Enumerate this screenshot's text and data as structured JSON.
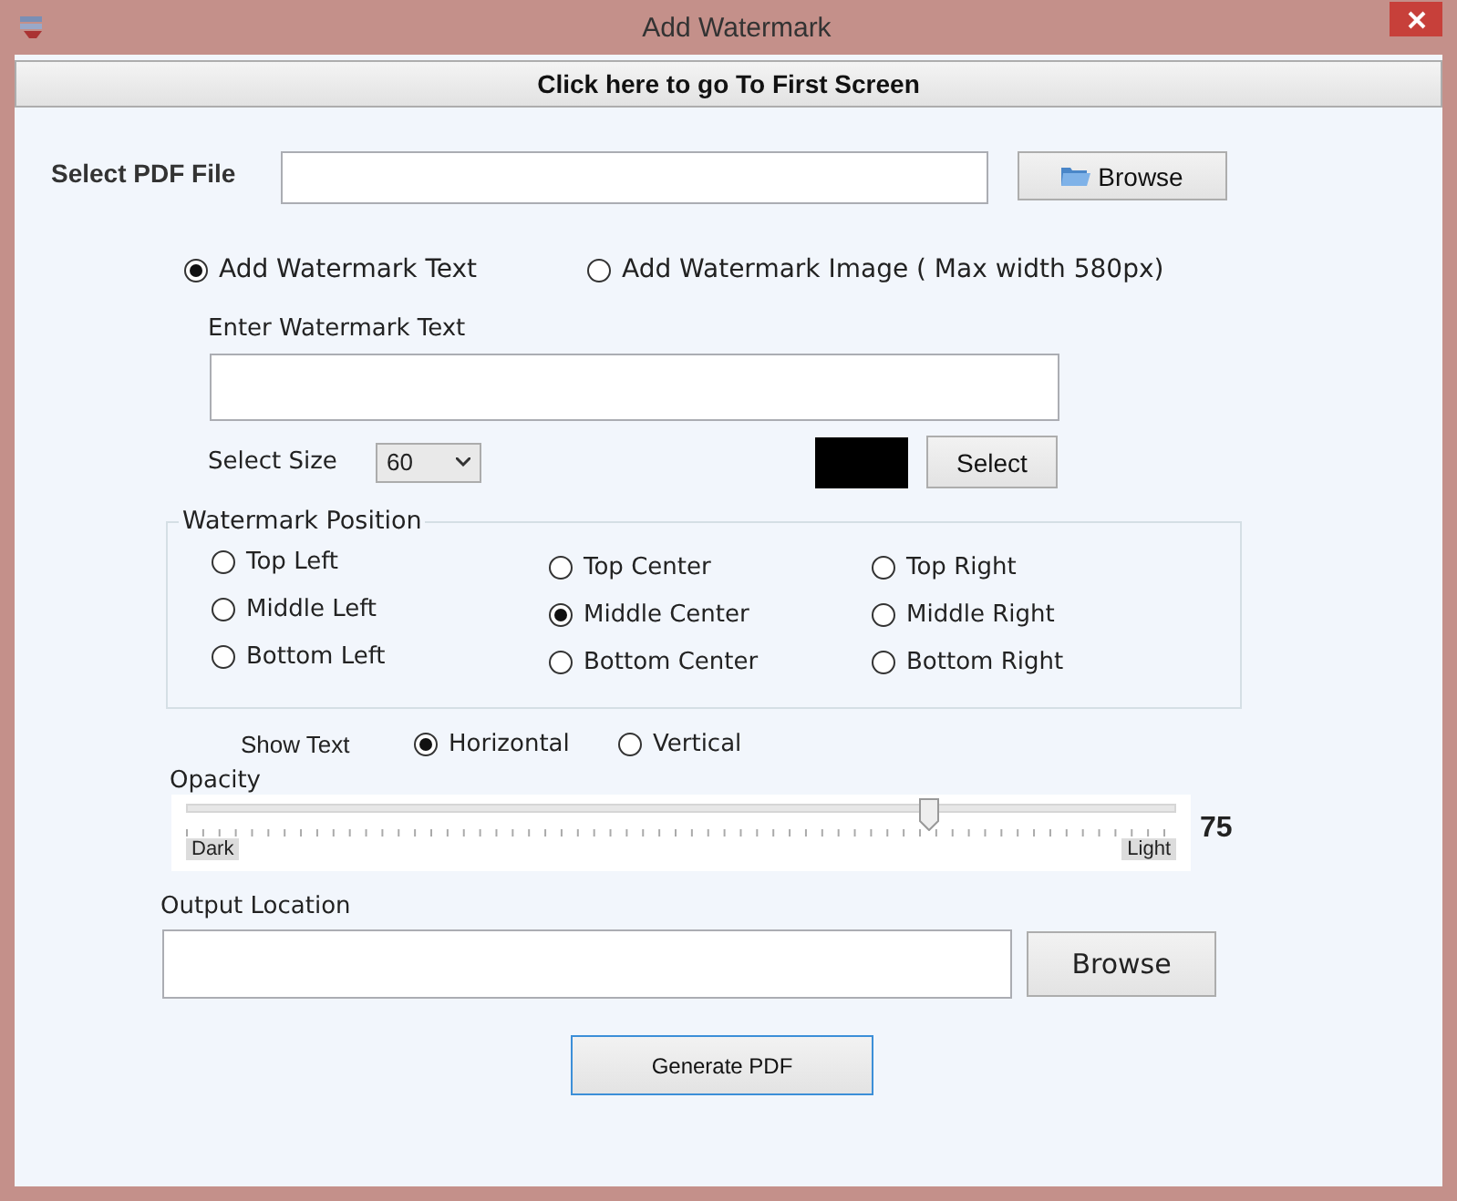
{
  "window": {
    "title": "Add Watermark"
  },
  "first_screen_button": "Click here to go To First Screen",
  "pdf_file": {
    "label": "Select PDF File",
    "browse": "Browse"
  },
  "mode_options": [
    {
      "label": "Add Watermark Text",
      "selected": true
    },
    {
      "label": "Add Watermark Image ( Max width 580px)",
      "selected": false
    }
  ],
  "watermark_text": {
    "label": "Enter Watermark Text"
  },
  "size": {
    "label": "Select Size",
    "value": "60"
  },
  "color": {
    "color": "#000000",
    "button": "Select"
  },
  "position": {
    "title": "Watermark Position",
    "options": [
      {
        "label": "Top Left",
        "selected": false
      },
      {
        "label": "Top Center",
        "selected": false
      },
      {
        "label": "Top Right",
        "selected": false
      },
      {
        "label": "Middle Left",
        "selected": false
      },
      {
        "label": "Middle Center",
        "selected": true
      },
      {
        "label": "Middle Right",
        "selected": false
      },
      {
        "label": "Bottom Left",
        "selected": false
      },
      {
        "label": "Bottom Center",
        "selected": false
      },
      {
        "label": "Bottom Right",
        "selected": false
      }
    ]
  },
  "show_text": {
    "label": "Show Text",
    "options": [
      {
        "label": "Horizontal",
        "selected": true
      },
      {
        "label": "Vertical",
        "selected": false
      }
    ]
  },
  "opacity": {
    "label": "Opacity",
    "level": 0.75,
    "min_label": "Dark",
    "max_label": "Light",
    "reading": "75"
  },
  "output": {
    "label": "Output Location",
    "browse": "Browse"
  },
  "generate_button": "Generate PDF"
}
